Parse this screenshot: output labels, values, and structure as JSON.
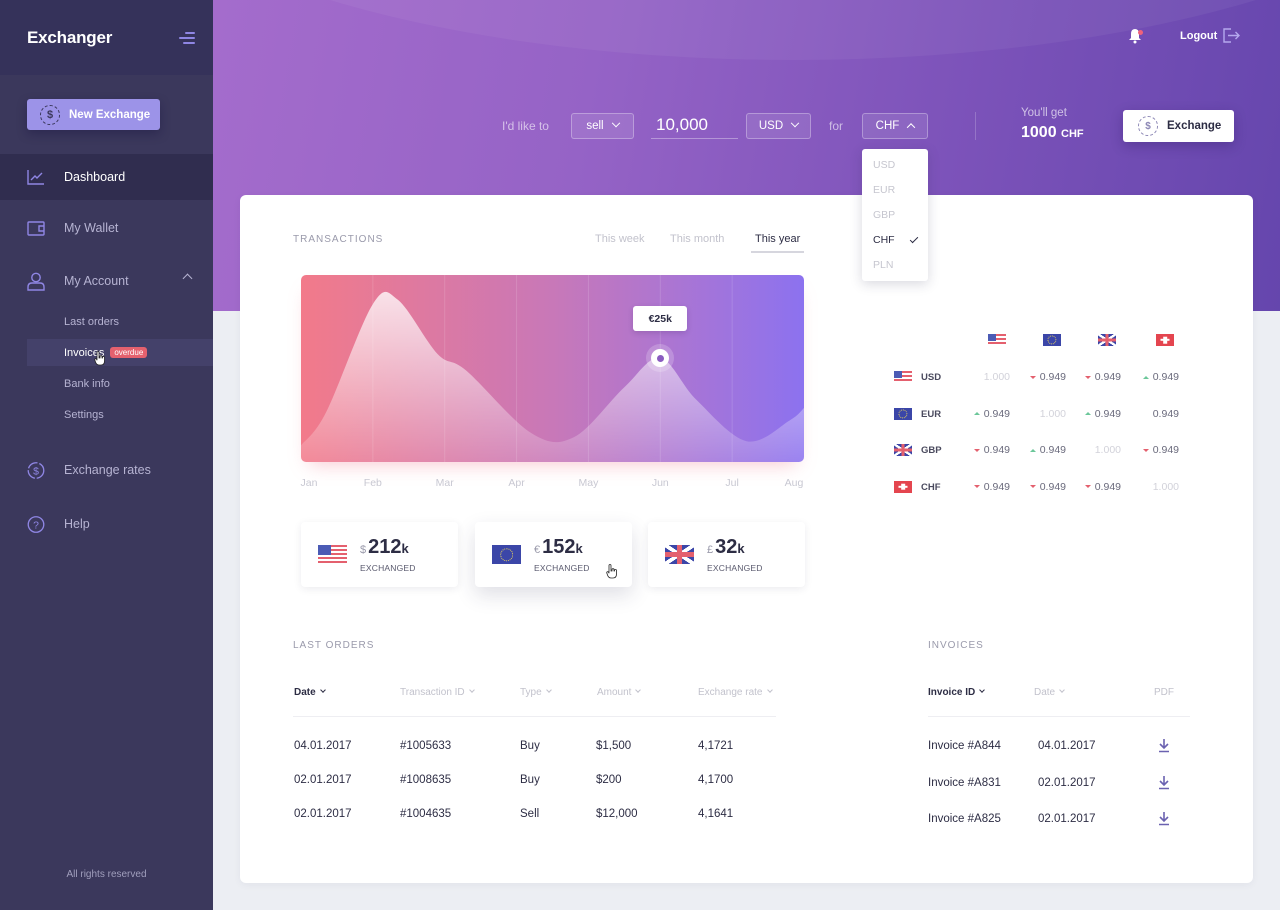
{
  "app": {
    "brand": "Exchanger",
    "footer": "All rights reserved"
  },
  "sidebar": {
    "new_exchange_label": "New Exchange",
    "items": [
      {
        "label": "Dashboard",
        "icon": "chart-line-icon",
        "active": true
      },
      {
        "label": "My Wallet",
        "icon": "wallet-icon"
      },
      {
        "label": "My Account",
        "icon": "user-icon",
        "expanded": true
      },
      {
        "label": "Exchange rates",
        "icon": "dollar-cycle-icon"
      },
      {
        "label": "Help",
        "icon": "help-circle-icon"
      }
    ],
    "account_sub": [
      {
        "label": "Last orders"
      },
      {
        "label": "Invoices",
        "badge": "overdue"
      },
      {
        "label": "Bank info"
      },
      {
        "label": "Settings"
      }
    ]
  },
  "header": {
    "logout_label": "Logout",
    "notification_dot": true,
    "exchange_form": {
      "prefix": "I'd like to",
      "action": "sell",
      "amount": "10,000",
      "from_currency": "USD",
      "connector": "for",
      "to_currency": "CHF",
      "you_get_label": "You'll get",
      "you_get_value": "1000",
      "you_get_currency": "CHF",
      "exchange_label": "Exchange"
    },
    "currency_dropdown": {
      "options": [
        "USD",
        "EUR",
        "GBP",
        "CHF",
        "PLN"
      ],
      "selected": "CHF"
    }
  },
  "transactions": {
    "title": "TRANSACTIONS",
    "tabs": [
      {
        "label": "This week"
      },
      {
        "label": "This month"
      },
      {
        "label": "This year",
        "active": true
      }
    ],
    "tooltip": "€25k"
  },
  "chart_data": {
    "type": "area",
    "title": "Transactions",
    "categories": [
      "Jan",
      "Feb",
      "Mar",
      "Apr",
      "May",
      "Jun",
      "Jul",
      "Aug"
    ],
    "x": [
      0,
      0.35,
      1,
      1.35,
      1.9,
      2.3,
      3.2,
      3.8,
      4.5,
      5.0,
      5.5,
      6.2,
      6.8,
      7.0
    ],
    "series": [
      {
        "name": "Transactions (€k)",
        "values": [
          4,
          12,
          38,
          39,
          26,
          22,
          7,
          6,
          18,
          25,
          15,
          5,
          10,
          13
        ]
      }
    ],
    "highlight": {
      "category": "Jun",
      "value": 25,
      "label": "€25k"
    },
    "ylim": [
      0,
      45
    ],
    "grid": true,
    "xlabel": "",
    "ylabel": ""
  },
  "stats": [
    {
      "currency_symbol": "$",
      "value": "212",
      "suffix": "k",
      "label": "EXCHANGED",
      "flag": "us"
    },
    {
      "currency_symbol": "€",
      "value": "152",
      "suffix": "k",
      "label": "EXCHANGED",
      "flag": "eu"
    },
    {
      "currency_symbol": "£",
      "value": "32",
      "suffix": "k",
      "label": "EXCHANGED",
      "flag": "gb"
    }
  ],
  "rates": {
    "columns": [
      "USD",
      "EUR",
      "GBP",
      "CHF"
    ],
    "rows": [
      {
        "code": "USD",
        "cells": [
          {
            "v": "1.000",
            "t": "same"
          },
          {
            "v": "0.949",
            "t": "down"
          },
          {
            "v": "0.949",
            "t": "down"
          },
          {
            "v": "0.949",
            "t": "up"
          }
        ]
      },
      {
        "code": "EUR",
        "cells": [
          {
            "v": "0.949",
            "t": "up"
          },
          {
            "v": "1.000",
            "t": "same"
          },
          {
            "v": "0.949",
            "t": "up"
          },
          {
            "v": "0.949",
            "t": "none"
          }
        ]
      },
      {
        "code": "GBP",
        "cells": [
          {
            "v": "0.949",
            "t": "down"
          },
          {
            "v": "0.949",
            "t": "up"
          },
          {
            "v": "1.000",
            "t": "same"
          },
          {
            "v": "0.949",
            "t": "down"
          }
        ]
      },
      {
        "code": "CHF",
        "cells": [
          {
            "v": "0.949",
            "t": "down"
          },
          {
            "v": "0.949",
            "t": "down"
          },
          {
            "v": "0.949",
            "t": "down"
          },
          {
            "v": "1.000",
            "t": "same"
          }
        ]
      }
    ]
  },
  "last_orders": {
    "title": "LAST ORDERS",
    "headers": [
      "Date",
      "Transaction ID",
      "Type",
      "Amount",
      "Exchange rate"
    ],
    "rows": [
      [
        "04.01.2017",
        "#1005633",
        "Buy",
        "$1,500",
        "4,1721"
      ],
      [
        "02.01.2017",
        "#1008635",
        "Buy",
        "$200",
        "4,1700"
      ],
      [
        "02.01.2017",
        "#1004635",
        "Sell",
        "$12,000",
        "4,1641"
      ]
    ]
  },
  "invoices": {
    "title": "INVOICES",
    "headers": [
      "Invoice ID",
      "Date",
      "PDF"
    ],
    "rows": [
      [
        "Invoice #A844",
        "04.01.2017"
      ],
      [
        "Invoice #A831",
        "02.01.2017"
      ],
      [
        "Invoice #A825",
        "02.01.2017"
      ]
    ]
  }
}
